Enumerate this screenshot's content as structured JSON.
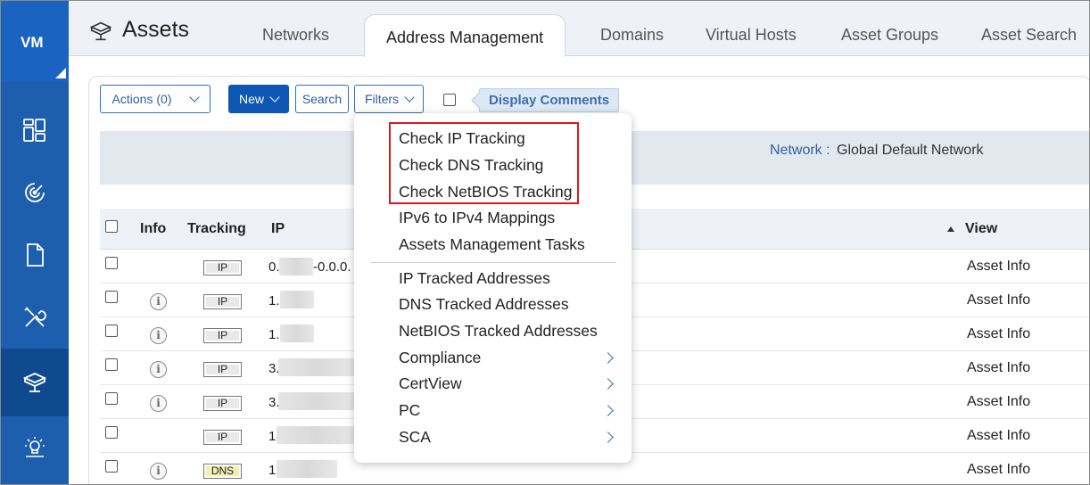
{
  "app": {
    "logo": "VM",
    "title": "Assets"
  },
  "tabs": [
    {
      "label": "Networks"
    },
    {
      "label": "Address Management",
      "active": true
    },
    {
      "label": "Domains"
    },
    {
      "label": "Virtual Hosts"
    },
    {
      "label": "Asset Groups"
    },
    {
      "label": "Asset Search"
    }
  ],
  "toolbar": {
    "actions_label": "Actions (0)",
    "new_label": "New",
    "search_label": "Search",
    "filters_label": "Filters",
    "display_comments": "Display Comments"
  },
  "network": {
    "label": "Network :",
    "value": "Global Default Network"
  },
  "table": {
    "headers": {
      "info": "Info",
      "tracking": "Tracking",
      "ip": "IP",
      "view": "View"
    },
    "rows": [
      {
        "info": false,
        "tracking": "IP",
        "ip_prefix": "0.",
        "ip_suffix": "-0.0.0.",
        "view": "Asset Info"
      },
      {
        "info": true,
        "tracking": "IP",
        "ip_prefix": "1.",
        "ip_suffix": "",
        "view": "Asset Info"
      },
      {
        "info": true,
        "tracking": "IP",
        "ip_prefix": "1.",
        "ip_suffix": "",
        "view": "Asset Info"
      },
      {
        "info": true,
        "tracking": "IP",
        "ip_prefix": "3.",
        "ip_suffix": "",
        "view": "Asset Info"
      },
      {
        "info": true,
        "tracking": "IP",
        "ip_prefix": "3.",
        "ip_suffix": "",
        "view": "Asset Info"
      },
      {
        "info": false,
        "tracking": "IP",
        "ip_prefix": "1",
        "ip_suffix": "",
        "view": "Asset Info"
      },
      {
        "info": true,
        "tracking": "DNS",
        "ip_prefix": "1",
        "ip_suffix": "",
        "view": "Asset Info"
      }
    ]
  },
  "new_menu": {
    "items": [
      {
        "label": "Check IP Tracking",
        "highlighted": true
      },
      {
        "label": "Check DNS Tracking",
        "highlighted": true
      },
      {
        "label": "Check NetBIOS Tracking",
        "highlighted": true
      },
      {
        "label": "IPv6 to IPv4 Mappings"
      },
      {
        "label": "Assets Management Tasks"
      },
      {
        "label": "IP Tracked Addresses"
      },
      {
        "label": "DNS Tracked Addresses"
      },
      {
        "label": "NetBIOS Tracked Addresses"
      },
      {
        "label": "Compliance",
        "submenu": true
      },
      {
        "label": "CertView",
        "submenu": true
      },
      {
        "label": "PC",
        "submenu": true
      },
      {
        "label": "SCA",
        "submenu": true
      }
    ]
  },
  "nav": [
    "dashboard-icon",
    "scans-icon",
    "reports-icon",
    "tools-icon",
    "assets-icon",
    "knowledgebase-icon"
  ],
  "colors": {
    "nav_bg": "#1d5fae",
    "accent": "#0e57b3",
    "highlight": "#d8191f"
  }
}
